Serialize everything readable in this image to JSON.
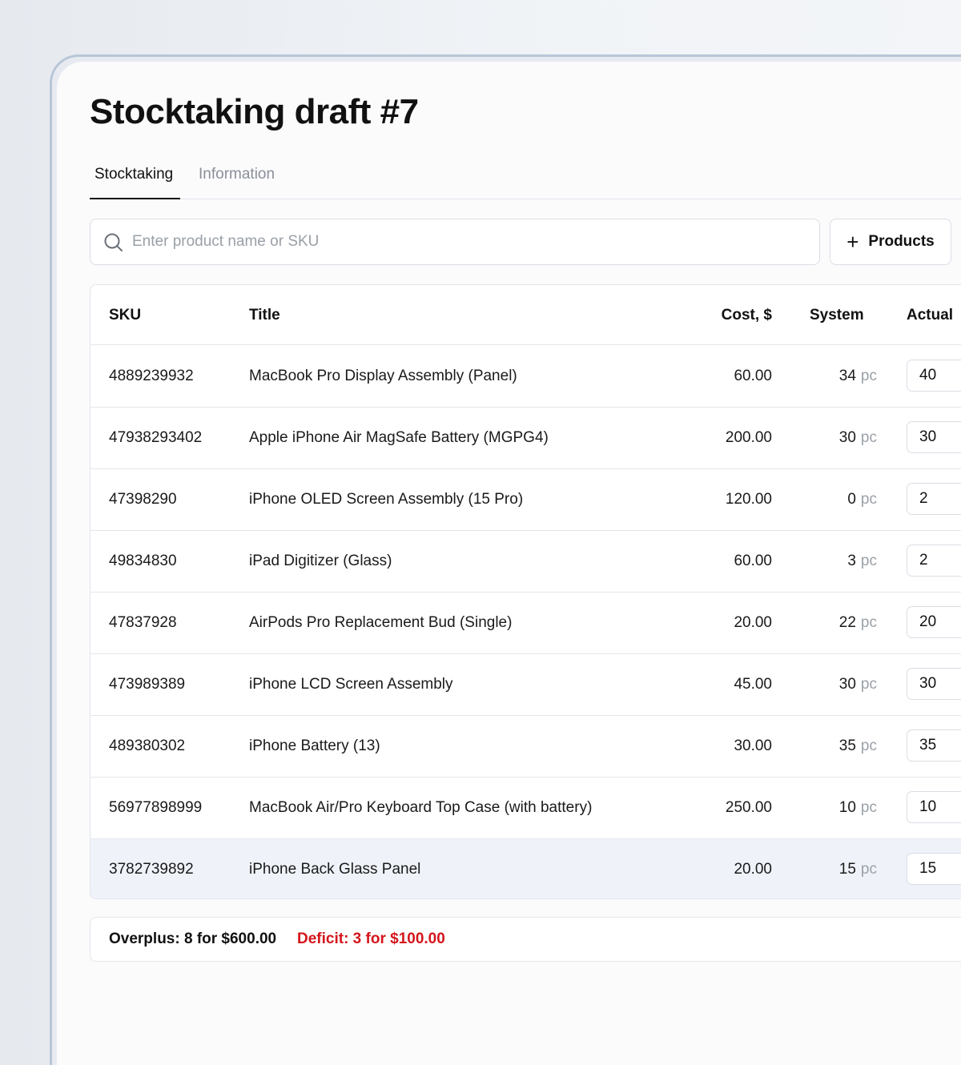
{
  "page": {
    "title": "Stocktaking draft #7"
  },
  "tabs": [
    {
      "label": "Stocktaking",
      "active": true
    },
    {
      "label": "Information",
      "active": false
    }
  ],
  "search": {
    "placeholder": "Enter product name or SKU",
    "value": ""
  },
  "toolbar": {
    "add_products_label": "Products",
    "add_icon": "plus-icon"
  },
  "table": {
    "columns": {
      "sku": "SKU",
      "title": "Title",
      "cost": "Cost, $",
      "system": "System",
      "actual": "Actual"
    },
    "unit": "pc",
    "rows": [
      {
        "sku": "4889239932",
        "title": "MacBook Pro Display Assembly (Panel)",
        "cost": "60.00",
        "system": "34",
        "actual": "40"
      },
      {
        "sku": "47938293402",
        "title": "Apple iPhone Air MagSafe Battery (MGPG4)",
        "cost": "200.00",
        "system": "30",
        "actual": "30"
      },
      {
        "sku": "47398290",
        "title": "iPhone OLED Screen Assembly (15 Pro)",
        "cost": "120.00",
        "system": "0",
        "actual": "2"
      },
      {
        "sku": "49834830",
        "title": "iPad Digitizer (Glass)",
        "cost": "60.00",
        "system": "3",
        "actual": "2"
      },
      {
        "sku": "47837928",
        "title": "AirPods Pro Replacement Bud (Single)",
        "cost": "20.00",
        "system": "22",
        "actual": "20"
      },
      {
        "sku": "473989389",
        "title": "iPhone LCD Screen Assembly",
        "cost": "45.00",
        "system": "30",
        "actual": "30"
      },
      {
        "sku": "489380302",
        "title": "iPhone Battery (13)",
        "cost": "30.00",
        "system": "35",
        "actual": "35"
      },
      {
        "sku": "56977898999",
        "title": "MacBook Air/Pro Keyboard Top Case (with battery)",
        "cost": "250.00",
        "system": "10",
        "actual": "10"
      },
      {
        "sku": "3782739892",
        "title": "iPhone Back Glass Panel",
        "cost": "20.00",
        "system": "15",
        "actual": "15",
        "highlighted": true
      }
    ]
  },
  "summary": {
    "overplus": "Overplus: 8 for $600.00",
    "deficit": "Deficit: 3 for $100.00"
  },
  "colors": {
    "deficit": "#d4151c",
    "highlight_row": "#eff3f9",
    "window_border": "#b8c6d8"
  }
}
